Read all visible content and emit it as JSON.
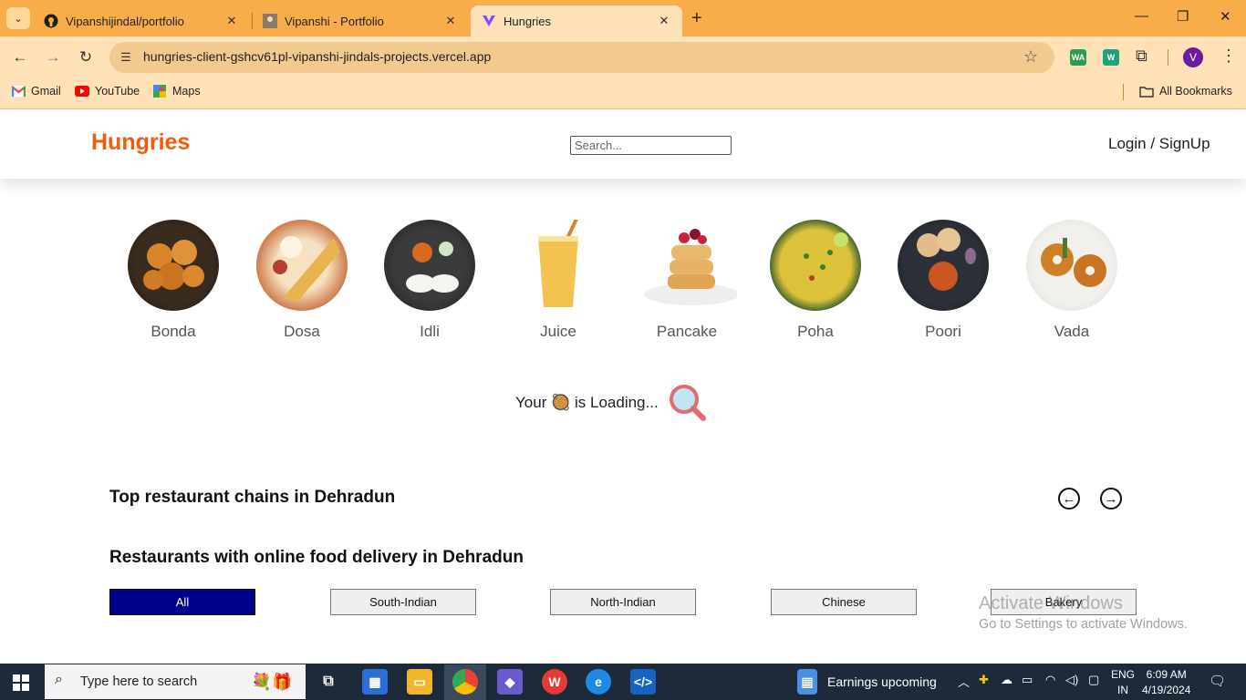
{
  "browser": {
    "tabs": [
      {
        "title": "Vipanshijindal/portfolio",
        "icon": "github-icon"
      },
      {
        "title": "Vipanshi - Portfolio",
        "icon": "portfolio-favicon-icon"
      },
      {
        "title": "Hungries",
        "icon": "vercel-v-icon",
        "active": true
      }
    ],
    "url": "hungries-client-gshcv61pl-vipanshi-jindals-projects.vercel.app",
    "bookmarks": [
      {
        "label": "Gmail",
        "icon": "gmail-icon"
      },
      {
        "label": "YouTube",
        "icon": "youtube-icon"
      },
      {
        "label": "Maps",
        "icon": "maps-icon"
      }
    ],
    "all_bookmarks": "All Bookmarks",
    "profile_initial": "V",
    "extensions": [
      "WA",
      "W"
    ]
  },
  "header": {
    "logo": "Hungries",
    "search_placeholder": "Search...",
    "login": "Login / SignUp"
  },
  "foods": [
    {
      "name": "Bonda"
    },
    {
      "name": "Dosa"
    },
    {
      "name": "Idli"
    },
    {
      "name": "Juice"
    },
    {
      "name": "Pancake"
    },
    {
      "name": "Poha"
    },
    {
      "name": "Poori"
    },
    {
      "name": "Vada"
    }
  ],
  "loading": {
    "prefix": "Your",
    "emoji": "🥘",
    "suffix": "is Loading..."
  },
  "sections": {
    "top_chains": "Top restaurant chains in Dehradun",
    "online_delivery": "Restaurants with online food delivery in Dehradun"
  },
  "filters": [
    "All",
    "South-Indian",
    "North-Indian",
    "Chinese",
    "Bakery"
  ],
  "active_filter": "All",
  "watermark": {
    "line1": "Activate Windows",
    "line2": "Go to Settings to activate Windows."
  },
  "taskbar": {
    "search": "Type here to search",
    "news": "Earnings upcoming",
    "lang1": "ENG",
    "lang2": "IN",
    "time": "6:09 AM",
    "date": "4/19/2024"
  },
  "colors": {
    "brand": "#f45a0e",
    "active_filter": "#00008b",
    "chrome": "#f9ad4a"
  }
}
